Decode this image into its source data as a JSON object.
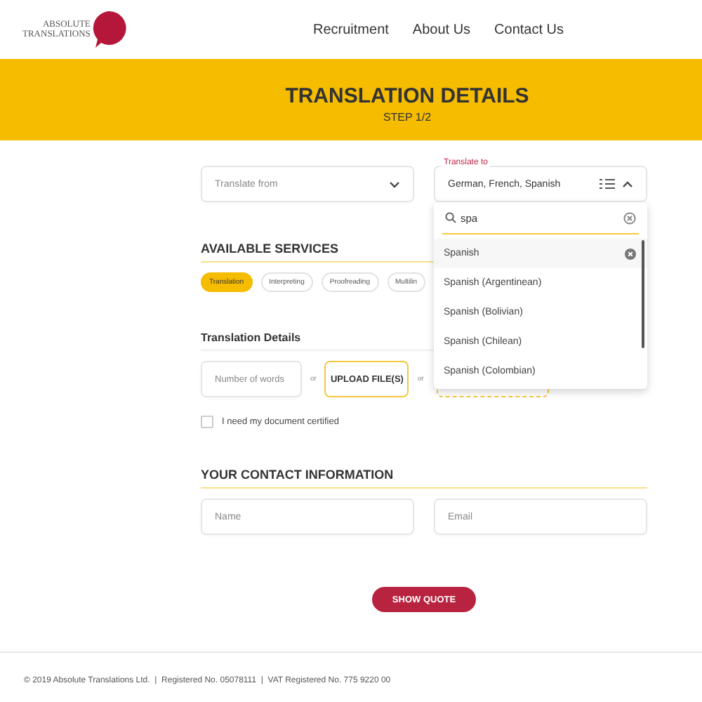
{
  "logo": {
    "line_1": "ABSOLUTE",
    "line_2": "TRANSLATIONS"
  },
  "nav": [
    {
      "label": "Recruitment"
    },
    {
      "label": "About Us"
    },
    {
      "label": "Contact Us"
    }
  ],
  "banner": {
    "title": "TRANSLATION DETAILS",
    "step": "STEP 1/2"
  },
  "translate_from": {
    "placeholder": "Translate from"
  },
  "translate_to": {
    "label": "Translate to",
    "value": "German, French, Spanish",
    "expanded": true
  },
  "dropdown": {
    "search": "spa",
    "options": [
      {
        "label": "Spanish",
        "selected": true
      },
      {
        "label": "Spanish (Argentinean)",
        "selected": false
      },
      {
        "label": "Spanish (Bolivian)",
        "selected": false
      },
      {
        "label": "Spanish (Chilean)",
        "selected": false
      },
      {
        "label": "Spanish (Colombian)",
        "selected": false
      }
    ]
  },
  "services": {
    "heading": "AVAILABLE SERVICES",
    "items": [
      {
        "label": "Translation",
        "selected": true
      },
      {
        "label": "Interpreting",
        "selected": false
      },
      {
        "label": "Proofreading",
        "selected": false
      },
      {
        "label": "Multilin",
        "selected": false
      }
    ]
  },
  "details": {
    "heading": "Translation Details",
    "words_placeholder": "Number of words",
    "or_1": "or",
    "upload": "UPLOAD FILE(S)",
    "or_2": "or",
    "certified": {
      "label": "I need my document certified",
      "checked": false
    }
  },
  "contact": {
    "heading": "YOUR CONTACT INFORMATION",
    "name_placeholder": "Name",
    "email_placeholder": "Email"
  },
  "submit": "SHOW QUOTE",
  "footer": "© 2019 Absolute Translations Ltd.  |  Registered No. 05078111  |  VAT Registered No. 775 9220 00"
}
